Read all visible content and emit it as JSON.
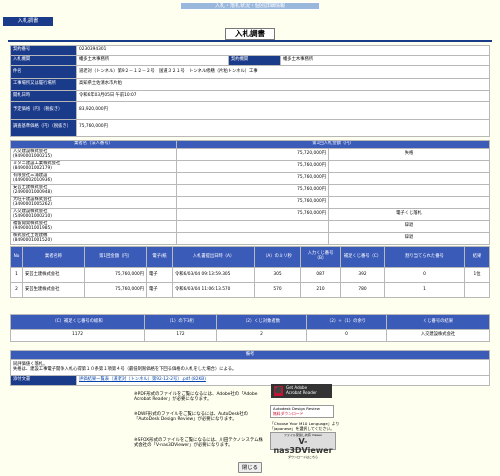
{
  "header": {
    "window_title": "入札・落札状況・個別詳細情報",
    "tag": "入札調書",
    "page_title": "入札調書"
  },
  "info": [
    {
      "label": "契約番号",
      "value": "0230394301"
    },
    {
      "label": "入札機関",
      "value": "幡多土木事務所",
      "label2": "契約機関",
      "value2": "幡多土木事務所"
    },
    {
      "label": "件名",
      "value": "道老対（トンネル）第9２－１２－２号　国道３２１号　トンネル修繕（片粕トンネル）工事"
    },
    {
      "label": "工事場所又は履行場所",
      "value": "高知県土佐清水市片粕"
    },
    {
      "label": "開札日時",
      "value": "令和6年03月05日 午前10:07"
    },
    {
      "label": "予定価格（円）（税抜き）",
      "value": "83,920,000円"
    },
    {
      "label": "調査基準価格（円）（税抜き）",
      "value": "75,760,000円"
    }
  ],
  "bids": {
    "headers": [
      "業者名（法人番号）",
      "第1回入札金額（円）"
    ],
    "rows": [
      {
        "name": "入交建設株式会社",
        "corp": "(9490001000215)",
        "amount": "75,720,000円",
        "note": "失格"
      },
      {
        "name": "ミタニ建設工業株式会社",
        "corp": "(8490001002179)",
        "amount": "75,760,000円",
        "note": ""
      },
      {
        "name": "有限会社三浦建設",
        "corp": "(4490002010936)",
        "amount": "75,760,000円",
        "note": ""
      },
      {
        "name": "安芸土建株式会社",
        "corp": "(2490001000948)",
        "amount": "75,760,000円",
        "note": ""
      },
      {
        "name": "大旺十建設株式会社",
        "corp": "(3490001005262)",
        "amount": "75,760,000円",
        "note": ""
      },
      {
        "name": "入交建設株式会社",
        "corp": "(5490001000210)",
        "amount": "75,760,000円",
        "note": "電子くじ落札"
      },
      {
        "name": "福留開発株式会社",
        "corp": "(9490001001985)",
        "amount": "",
        "note": "辞退"
      },
      {
        "name": "株式会社土佐建機",
        "corp": "(8490001001520)",
        "amount": "",
        "note": "辞退"
      }
    ]
  },
  "lottery": {
    "headers": [
      "No",
      "業者名称",
      "第1回金額（円）",
      "電子/紙",
      "入札書提出日時（A）",
      "（A）のミリ秒",
      "入力くじ番号（B）",
      "補足くじ番号（C）",
      "割り当てられた番号",
      "結果"
    ],
    "rows": [
      {
        "no": "1",
        "name": "安芸土建株式会社",
        "amount": "75,760,000円",
        "type": "電子",
        "datetime": "令和6/03/04 09:13:59.305",
        "ms": "305",
        "b": "087",
        "c": "392",
        "assigned": "0",
        "result": "1位"
      },
      {
        "no": "2",
        "name": "安芸生建株式会社",
        "amount": "75,760,000円",
        "type": "電子",
        "datetime": "令和6/03/04 11:06:13.570",
        "ms": "570",
        "b": "210",
        "c": "780",
        "assigned": "1",
        "result": ""
      }
    ]
  },
  "calc": {
    "headers": [
      "（C）補足くじ番号の総和",
      "（1）の下3桁",
      "（2）くじ対象者数",
      "（2）÷（1）の余り",
      "くじ番号の結果"
    ],
    "values": [
      "1172",
      "172",
      "2",
      "0",
      "入交建設株式会社"
    ]
  },
  "remarks": {
    "header": "備考",
    "line1": "同評価値く落札。",
    "line2": "失格は、建設工事電子開争入札心得第１０条第１項第４号（最低制限価格を下回る価格の入札をした場合）による。",
    "attach_label": "添付文書",
    "attach_link": "評価結果一覧表（道老対（トンネル）第92-12-2号）.pdf (82KB)"
  },
  "notes": {
    "pdf": "※PDF形式のファイルをご覧になるには、Adobe社の「Adobe Acrobat Reader」が必要になります。",
    "dwf": "※DWF形式のファイルをご覧になるには、AutoDesk社の「AutoDesk Design Review」が必要になります。",
    "m10": "「Choose Your M10 Language」より「Japanese」を選択してください。",
    "sfx": "※SFOX形式のファイルをご覧になるには、川田テクノシステム株式会社の「V-nas3DViewer」が必要になります。",
    "adobe_icon_l1": "Get Adobe",
    "adobe_icon_l2": "Acrobat Reader",
    "dr_icon_l1": "Autodesk Design Review",
    "dr_icon_l2": "無料ダウンロード",
    "vnas_small": "ファイル受渡し共有 Viewer",
    "vnas_big": "V-nas3DViewer",
    "vnas_dl": "ダウンロードはこちら"
  },
  "close_label": "閉じる"
}
